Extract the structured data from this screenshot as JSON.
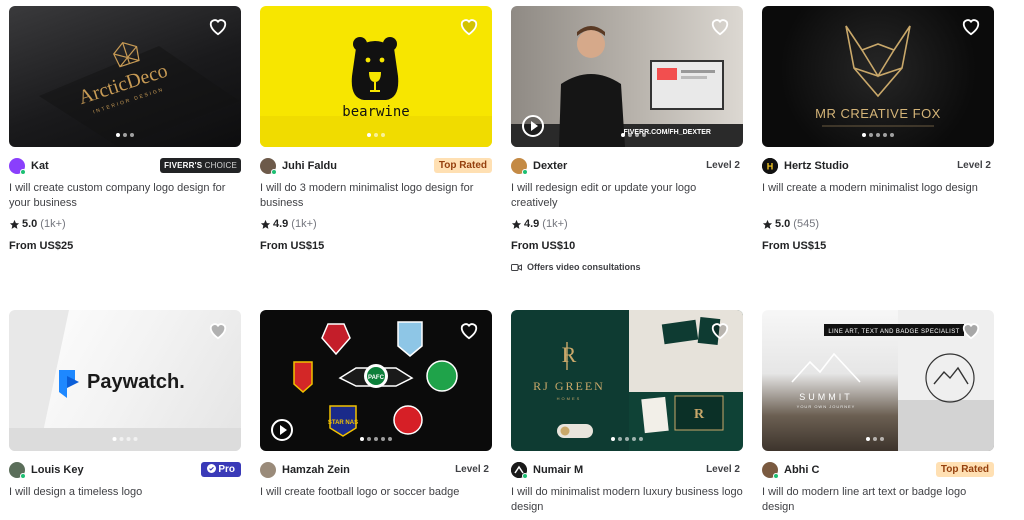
{
  "gigs": [
    {
      "seller": "Kat",
      "badge": {
        "type": "choice",
        "label_bold": "FIVERR'S",
        "label_rest": " CHOICE"
      },
      "title": "I will create custom company logo design for your business",
      "rating": "5.0",
      "reviews": "(1k+)",
      "price": "From US$25",
      "thumb_text": "ArcticDeco",
      "thumb_subtext": "INTERIOR DESIGN",
      "colors": {
        "thumb": "#1c1c1e",
        "avatar": "#8a3ffc"
      }
    },
    {
      "seller": "Juhi Faldu",
      "badge": {
        "type": "top",
        "label": "Top Rated"
      },
      "title": "I will do 3 modern minimalist logo design for business",
      "rating": "4.9",
      "reviews": "(1k+)",
      "price": "From US$15",
      "thumb_text": "bearwine",
      "colors": {
        "thumb": "#f7e600",
        "avatar": "#6d5a4a"
      }
    },
    {
      "seller": "Dexter",
      "badge": {
        "type": "level",
        "label": "Level 2"
      },
      "title": "I will redesign edit or update your logo creatively",
      "rating": "4.9",
      "reviews": "(1k+)",
      "price": "From US$10",
      "extra": "Offers video consultations",
      "thumb_text": "FIVERR.COM/FH_DEXTER",
      "colors": {
        "thumb": "#6e6b66",
        "avatar": "#c48a45"
      }
    },
    {
      "seller": "Hertz Studio",
      "badge": {
        "type": "level",
        "label": "Level 2"
      },
      "title": "I will create a modern minimalist logo design",
      "rating": "5.0",
      "reviews": "(545)",
      "price": "From US$15",
      "thumb_text": "MR CREATIVE FOX",
      "colors": {
        "thumb": "#0f0f0f",
        "avatar": "#111111"
      }
    },
    {
      "seller": "Louis Key",
      "badge": {
        "type": "pro",
        "label": "Pro"
      },
      "title": "I will design a timeless logo",
      "thumb_text": "Paywatch.",
      "colors": {
        "thumb": "#f2f2f2",
        "avatar": "#5b6e5a"
      }
    },
    {
      "seller": "Hamzah Zein",
      "badge": {
        "type": "level",
        "label": "Level 2"
      },
      "title": "I will create football logo or soccer badge",
      "thumb_text": "PAFC",
      "thumb_subtext": "STAR NAS",
      "colors": {
        "thumb": "#0b0b0b",
        "avatar": "#9a8b7a"
      }
    },
    {
      "seller": "Numair M",
      "badge": {
        "type": "level",
        "label": "Level 2"
      },
      "title": "I will do minimalist modern luxury business logo design",
      "thumb_text": "RJ GREEN",
      "thumb_subtext": "HOMES",
      "colors": {
        "thumb": "#0e3b32",
        "avatar": "#1a1a1a"
      }
    },
    {
      "seller": "Abhi C",
      "badge": {
        "type": "top",
        "label": "Top Rated"
      },
      "title": "I will do modern line art text or badge logo design",
      "thumb_text": "SUMMIT",
      "thumb_subtext": "YOUR OWN JOURNEY",
      "thumb_banner": "LINE ART, TEXT AND BADGE SPECIALIST",
      "colors": {
        "thumb": "#3a3a3a",
        "avatar": "#7a5a40"
      }
    }
  ]
}
